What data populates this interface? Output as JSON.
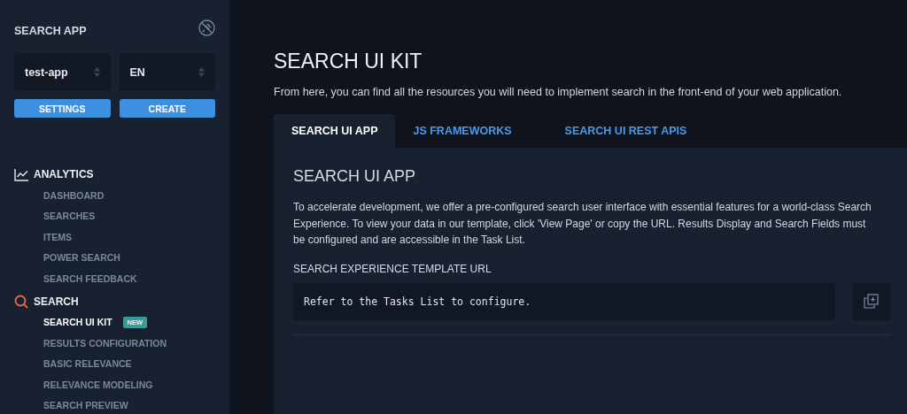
{
  "sidebar": {
    "title": "SEARCH APP",
    "app_select": {
      "value": "test-app"
    },
    "language_select": {
      "value": "EN"
    },
    "buttons": [
      "SETTINGS",
      "CREATE"
    ],
    "groups": [
      {
        "label": "ANALYTICS",
        "kind": "chart",
        "items": [
          {
            "label": "DASHBOARD",
            "selected": false
          },
          {
            "label": "SEARCHES",
            "selected": false
          },
          {
            "label": "ITEMS",
            "selected": false
          },
          {
            "label": "POWER SEARCH",
            "selected": false
          },
          {
            "label": "SEARCH FEEDBACK",
            "selected": false
          }
        ]
      },
      {
        "label": "SEARCH",
        "kind": "search",
        "items": [
          {
            "label": "SEARCH UI KIT",
            "selected": true,
            "badge": "NEW"
          },
          {
            "label": "RESULTS CONFIGURATION",
            "selected": false
          },
          {
            "label": "BASIC RELEVANCE",
            "selected": false
          },
          {
            "label": "RELEVANCE MODELING",
            "selected": false
          },
          {
            "label": "SEARCH PREVIEW",
            "selected": false
          }
        ]
      }
    ]
  },
  "main": {
    "title": "SEARCH UI KIT",
    "description": "From here, you can find all the resources you will need to implement search in the front-end of your web application.",
    "tabs": [
      {
        "label": "SEARCH UI APP",
        "selected": true
      },
      {
        "label": "JS FRAMEWORKS",
        "selected": false
      },
      {
        "label": "SEARCH UI REST APIS",
        "selected": false
      }
    ],
    "panel": {
      "title": "SEARCH UI APP",
      "text": "To accelerate development, we offer a pre-configured search user interface with essential features for a world-class Search Experience. To view your data in our template, click 'View Page' or copy the URL. Results Display and Search Fields must be configured and are accessible in the Task List.",
      "field_label": "SEARCH EXPERIENCE TEMPLATE URL",
      "url_value": "Refer to the Tasks List to configure."
    }
  }
}
